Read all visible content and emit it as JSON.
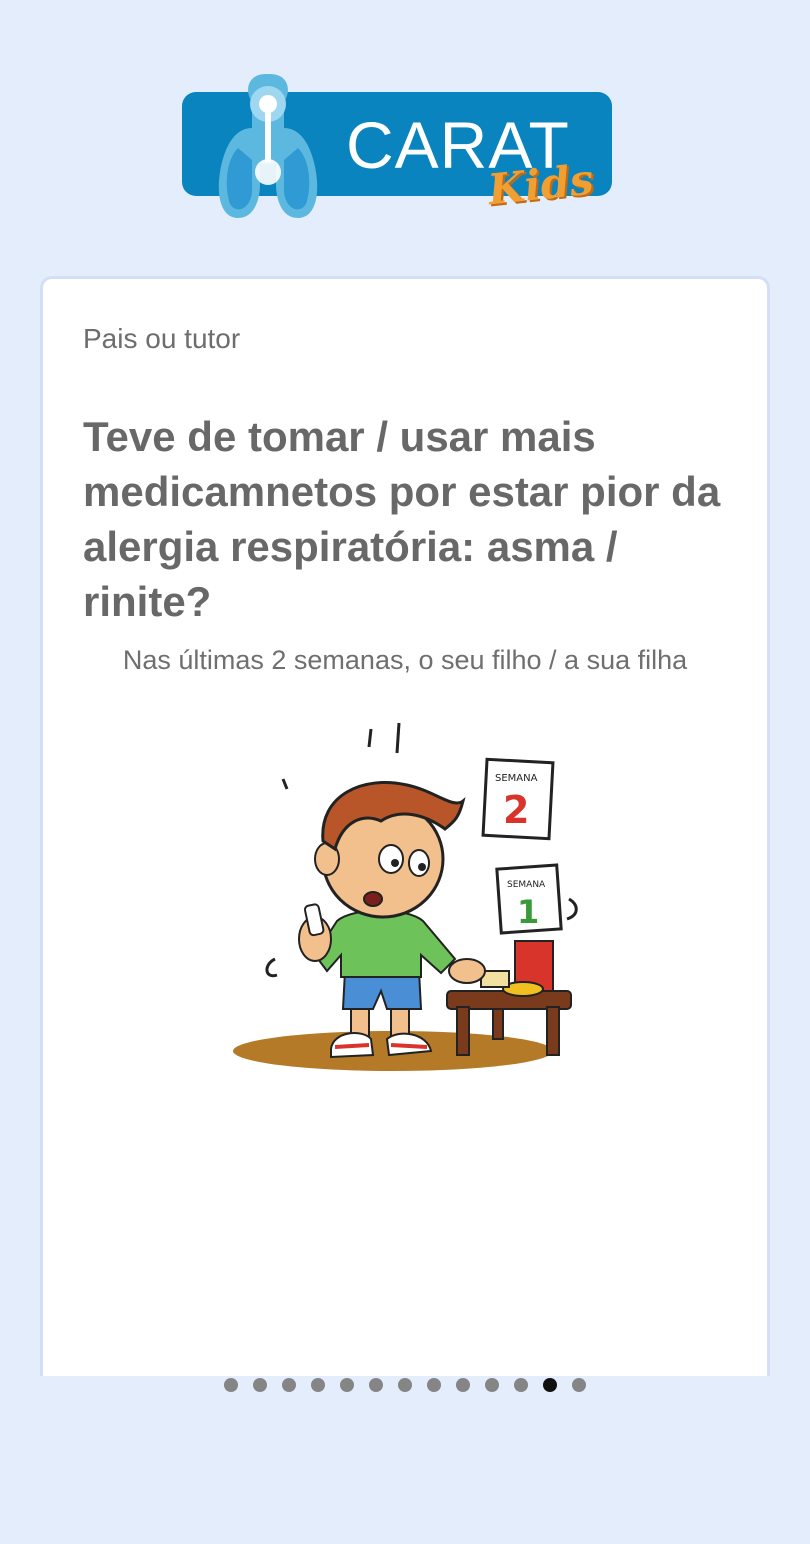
{
  "logo": {
    "title": "CARAT",
    "subtitle": "Kids",
    "brand_color": "#0a84bf",
    "accent_color": "#f0a033"
  },
  "card": {
    "role_label": "Pais ou tutor",
    "question": "Teve de tomar / usar mais medicamnetos por estar pior da alergia respiratória: asma / rinite?",
    "subtitle": "Nas últimas 2 semanas, o seu filho / a sua filha",
    "illustration": {
      "icon": "boy-with-inhaler-illustration",
      "calendar_top_label": "SEMANA",
      "calendar_top_number": "2",
      "calendar_bottom_label": "SEMANA",
      "calendar_bottom_number": "1"
    }
  },
  "pagination": {
    "total": 13,
    "active_index": 11
  }
}
